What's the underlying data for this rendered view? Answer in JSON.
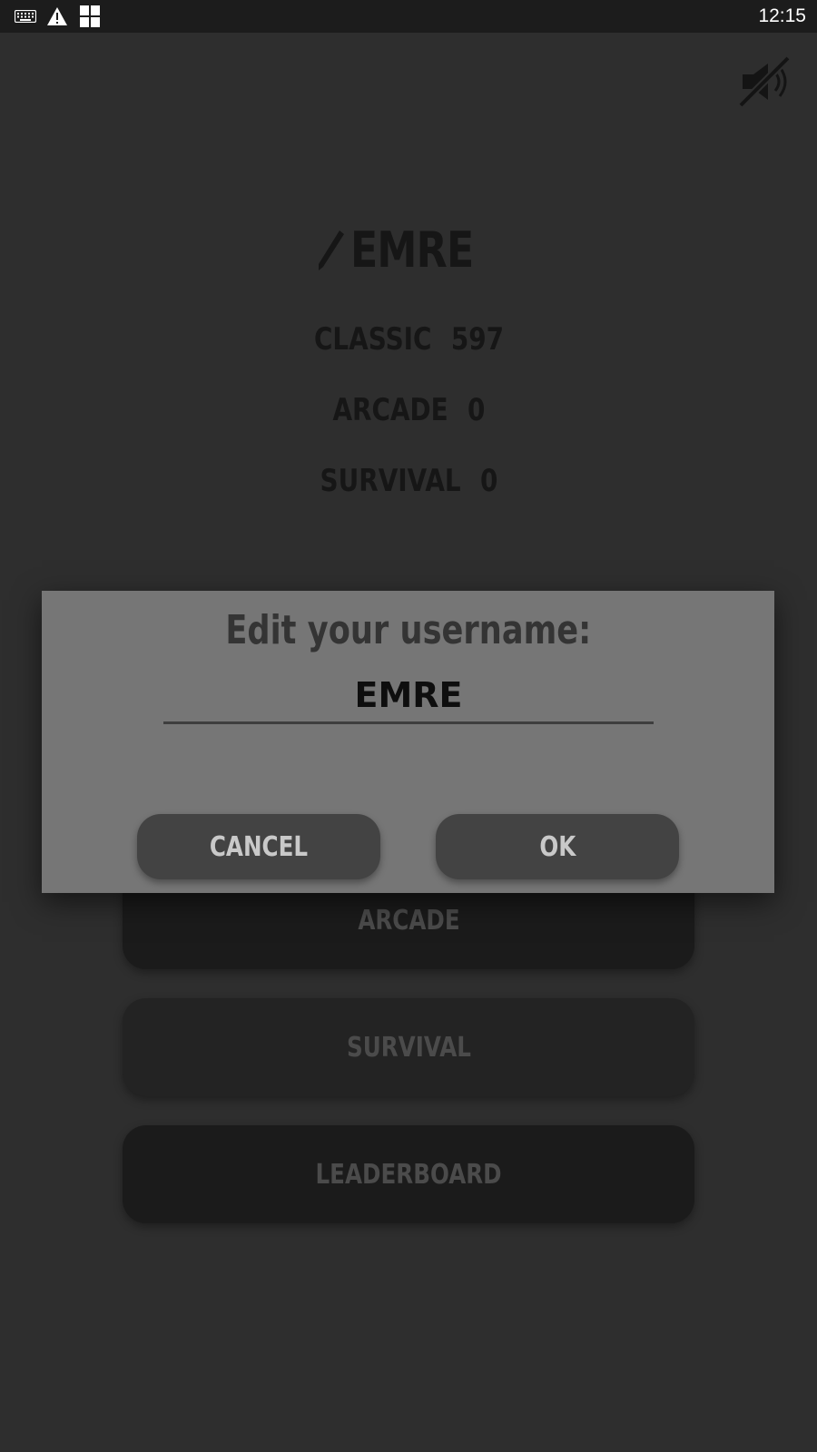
{
  "status_bar": {
    "time": "12:15",
    "icons": [
      "keyboard-icon",
      "warning-icon",
      "app-grid-icon"
    ]
  },
  "sound": {
    "icon": "speaker-muted-icon",
    "state": "muted"
  },
  "profile": {
    "edit_icon": "pencil-icon",
    "username": "EMRE",
    "scores": [
      {
        "mode": "CLASSIC",
        "value": "597"
      },
      {
        "mode": "ARCADE",
        "value": "0"
      },
      {
        "mode": "SURVIVAL",
        "value": "0"
      }
    ]
  },
  "menu": {
    "buttons": [
      {
        "label": "ARCADE"
      },
      {
        "label": "SURVIVAL"
      },
      {
        "label": "LEADERBOARD"
      }
    ]
  },
  "dialog": {
    "title": "Edit your username:",
    "input_value": "EMRE",
    "cancel_label": "CANCEL",
    "ok_label": "OK"
  },
  "colors": {
    "background": "#2e2e2e",
    "status_bar": "#1c1c1c",
    "dialog": "#767676",
    "dialog_button": "#434343"
  }
}
